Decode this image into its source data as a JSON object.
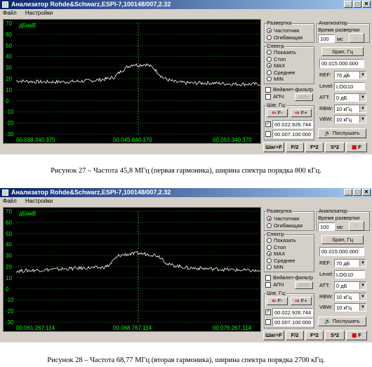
{
  "screens": [
    {
      "title": "Анализатор Rohde&Schwarz,ESPI-7,100148/007,2.32",
      "menu": [
        "Файл",
        "Настройки"
      ],
      "plot": {
        "unit": "дБмкВ",
        "y_ticks": [
          "70",
          "60",
          "50",
          "40",
          "30",
          "20",
          "10",
          "0",
          "-10",
          "-20",
          "-30"
        ],
        "x_labels": [
          "00.038.340.370",
          "00.045.840.370",
          "00.053.340.370"
        ]
      },
      "panel": {
        "razvertka_title": "Развертка",
        "razvertka_opts": [
          "Частотная",
          "Огибающая"
        ],
        "razvertka_selected": 0,
        "spektr_title": "Спектр",
        "spektr_opts": [
          "Показать",
          "Стоп",
          "MAX",
          "Среднее",
          "MIN"
        ],
        "spektr_selected": 2,
        "veivlet": "Вейвлет-фильтр",
        "apch": "АПЧ",
        "apu": "АПУ",
        "shag_title": "Шаг, Гц:",
        "f_minus": "F-",
        "f_plus": "F+",
        "field1": "00.022.926.744",
        "field2": "00.007.100.000",
        "analyzer_title": "Анализатор",
        "sweep_time_label": "Время развертки",
        "sweep_value": "100",
        "sweep_unit": "мс",
        "span_btn": "Span, Гц",
        "span_value": "00.015.000.000",
        "ref_label": "REF:",
        "ref_value": "70 дБ",
        "level_label": "Level:",
        "level_value": "LOG10",
        "att_label": "ATT:",
        "att_value": "0 дБ",
        "rbw_label": "RBW:",
        "rbw_value": "10 кГц",
        "vbw_label": "VBW:",
        "vbw_value": "10 кГц",
        "listen_btn": "Послушать",
        "bottom_btns": [
          "Шаг=F",
          "F/2",
          "F*2",
          "S*2",
          "F"
        ]
      },
      "chart_data": {
        "type": "line",
        "ylim": [
          -30,
          70
        ],
        "x_range_labels": [
          "00.038.340.370",
          "00.053.340.370"
        ],
        "x": [
          0,
          0.1,
          0.2,
          0.3,
          0.35,
          0.4,
          0.42,
          0.45,
          0.48,
          0.5,
          0.53,
          0.56,
          0.6,
          0.62,
          0.65,
          0.7,
          0.8,
          0.9,
          1.0
        ],
        "y": [
          18,
          17,
          17,
          18,
          19,
          21,
          25,
          30,
          33,
          32,
          33,
          30,
          21,
          19,
          17,
          16,
          16,
          15,
          15
        ]
      },
      "caption": "Рисунок 27 – Частота 45,8 МГц (первая гармоника), ширина спектра порядка 800 кГц."
    },
    {
      "title": "Анализатор Rohde&Schwarz,ESPI-7,100148/007,2.32",
      "menu": [
        "Файл",
        "Настройки"
      ],
      "plot": {
        "unit": "дБмкВ",
        "y_ticks": [
          "70",
          "60",
          "50",
          "40",
          "30",
          "20",
          "10",
          "0",
          "-10",
          "-20",
          "-30"
        ],
        "x_labels": [
          "00.061.267.114",
          "00.068.767.114",
          "00.076.267.114"
        ]
      },
      "panel": {
        "razvertka_title": "Развертка",
        "razvertka_opts": [
          "Частотная",
          "Огибающая"
        ],
        "razvertka_selected": 0,
        "spektr_title": "Спектр",
        "spektr_opts": [
          "Показать",
          "Стоп",
          "MAX",
          "Среднее",
          "MIN"
        ],
        "spektr_selected": 2,
        "veivlet": "Вейвлет-фильтр",
        "apch": "АПЧ",
        "apu": "АПУ",
        "shag_title": "Шаг, Гц:",
        "f_minus": "F-",
        "f_plus": "F+",
        "field1": "00.022.926.744",
        "field2": "00.007.100.000",
        "analyzer_title": "Анализатор",
        "sweep_time_label": "Время развертки",
        "sweep_value": "100",
        "sweep_unit": "мс",
        "span_btn": "Span, Гц",
        "span_value": "00.015.000.000",
        "ref_label": "REF:",
        "ref_value": "70 дБ",
        "level_label": "Level:",
        "level_value": "LOG10",
        "att_label": "ATT:",
        "att_value": "0 дБ",
        "rbw_label": "RBW:",
        "rbw_value": "10 кГц",
        "vbw_label": "VBW:",
        "vbw_value": "10 кГц",
        "listen_btn": "Послушать",
        "bottom_btns": [
          "Шаг=F",
          "F/2",
          "F*2",
          "S*2",
          "F"
        ]
      },
      "chart_data": {
        "type": "line",
        "ylim": [
          -30,
          70
        ],
        "x_range_labels": [
          "00.061.267.114",
          "00.076.267.114"
        ],
        "x": [
          0,
          0.1,
          0.2,
          0.3,
          0.35,
          0.38,
          0.4,
          0.42,
          0.45,
          0.5,
          0.55,
          0.58,
          0.6,
          0.62,
          0.65,
          0.7,
          0.8,
          0.9,
          1.0
        ],
        "y": [
          16,
          17,
          18,
          19,
          19,
          21,
          26,
          30,
          31,
          32,
          31,
          30,
          27,
          22,
          21,
          19,
          18,
          17,
          16
        ]
      },
      "caption": "Рисунок 28 – Частота 68,77 МГц (вторая гармоника), ширина спектра порядка 2700 кГц."
    }
  ]
}
